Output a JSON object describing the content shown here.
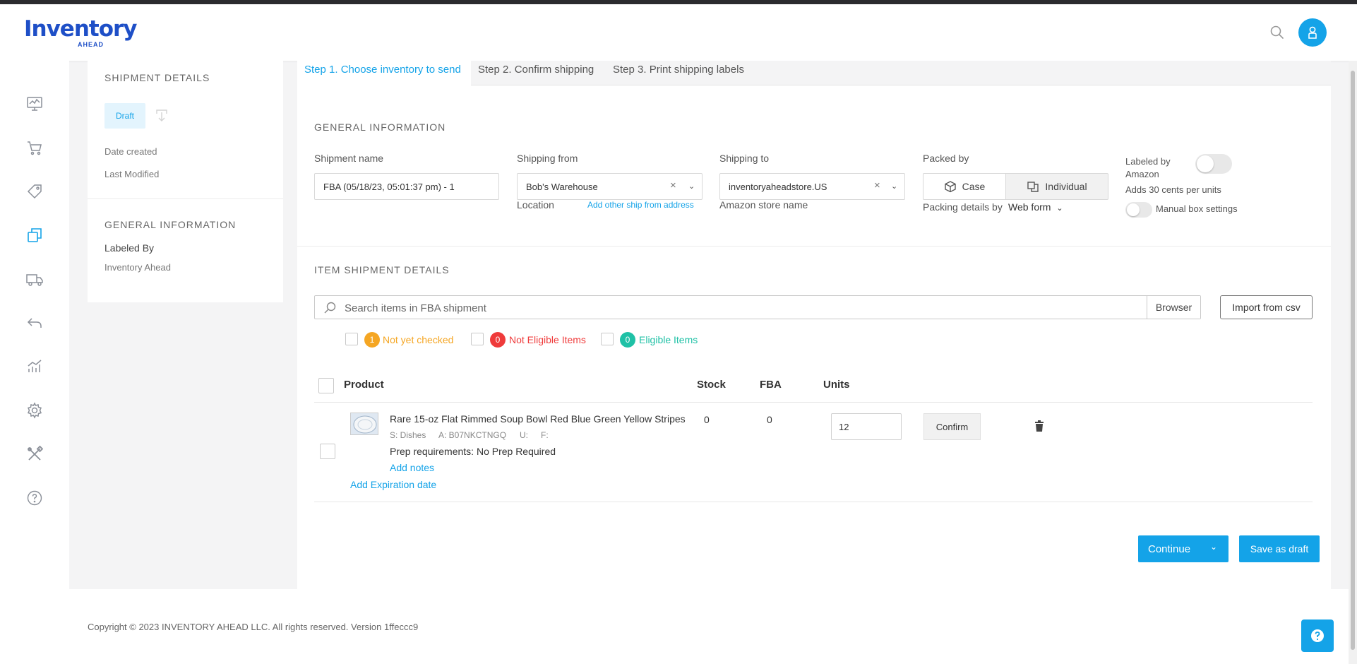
{
  "brand": {
    "logo_main": "Inventory",
    "logo_sub": "AHEAD"
  },
  "header": {
    "search_icon": "search-icon",
    "avatar_icon": "user-icon"
  },
  "sidebar": {
    "items": [
      {
        "icon": "dashboard-monitor-icon"
      },
      {
        "icon": "cart-icon"
      },
      {
        "icon": "tag-icon"
      },
      {
        "icon": "copy-shipments-icon",
        "active": true
      },
      {
        "icon": "truck-icon"
      },
      {
        "icon": "return-icon"
      },
      {
        "icon": "analytics-chart-icon"
      },
      {
        "icon": "gear-icon"
      },
      {
        "icon": "tools-icon"
      },
      {
        "icon": "help-circle-icon"
      }
    ]
  },
  "left_panel": {
    "shipment_details_title": "SHIPMENT DETAILS",
    "status_badge": "Draft",
    "date_created_label": "Date created",
    "last_modified_label": "Last Modified",
    "general_info_title": "GENERAL INFORMATION",
    "labeled_by_label": "Labeled By",
    "labeled_by_value": "Inventory Ahead"
  },
  "tabs": [
    {
      "label": "Step 1. Choose inventory to send",
      "active": true
    },
    {
      "label": "Step 2. Confirm shipping",
      "active": false
    },
    {
      "label": "Step 3. Print shipping labels",
      "active": false
    }
  ],
  "general": {
    "title": "GENERAL INFORMATION",
    "shipment_name_label": "Shipment name",
    "shipment_name_value": "FBA (05/18/23, 05:01:37 pm) - 1",
    "shipping_from_label": "Shipping from",
    "shipping_from_value": "Bob's Warehouse",
    "location_label": "Location",
    "add_ship_from": "Add other ship from address",
    "shipping_to_label": "Shipping to",
    "shipping_to_value": "inventoryaheadstore.US",
    "amazon_store_label": "Amazon store name",
    "packed_by_label": "Packed by",
    "pack_case": "Case",
    "pack_individual": "Individual",
    "packing_details_label": "Packing details by",
    "packing_details_value": "Web form",
    "labeled_by_amazon_line1": "Labeled by",
    "labeled_by_amazon_line2": "Amazon",
    "adds_cents": "Adds 30 cents per units",
    "manual_box": "Manual box settings"
  },
  "items": {
    "title": "ITEM SHIPMENT DETAILS",
    "search_placeholder": "Search items in FBA shipment",
    "browser_label": "Browser",
    "import_label": "Import from csv",
    "filters": [
      {
        "count": "1",
        "label": "Not yet checked",
        "color": "#f5a623"
      },
      {
        "count": "0",
        "label": "Not Eligible Items",
        "color": "#ef3b3b"
      },
      {
        "count": "0",
        "label": "Eligible Items",
        "color": "#1fc1a6"
      }
    ],
    "columns": {
      "product": "Product",
      "stock": "Stock",
      "fba": "FBA",
      "units": "Units"
    },
    "rows": [
      {
        "title": "Rare 15-oz Flat Rimmed Soup Bowl Red Blue Green Yellow Stripes",
        "sku": "S: Dishes",
        "asin": "A: B07NKCTNGQ",
        "u": "U:",
        "f": "F:",
        "prep_label": "Prep requirements:",
        "prep_value": "No Prep Required",
        "add_notes": "Add notes",
        "add_expiration": "Add Expiration date",
        "stock": "0",
        "fba": "0",
        "units": "12",
        "confirm": "Confirm"
      }
    ]
  },
  "actions": {
    "continue": "Continue",
    "save_draft": "Save as draft"
  },
  "footer": {
    "copyright": "Copyright © 2023 INVENTORY AHEAD LLC. All rights reserved. Version 1ffeccc9"
  },
  "colors": {
    "accent": "#14a3e8",
    "brand": "#1e4fc7"
  }
}
